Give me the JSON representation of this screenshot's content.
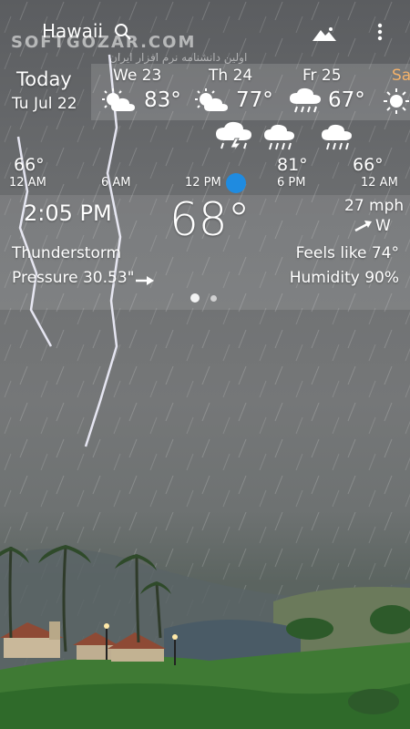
{
  "header": {
    "city": "Hawaii",
    "watermark_title": "SOFTGOZAR.COM",
    "watermark_sub": "اولین دانشنامه نرم افزار ایران"
  },
  "today": {
    "label": "Today",
    "date": "Tu Jul 22"
  },
  "forecast": [
    {
      "day": "We 23",
      "temp": "83°",
      "icon": "partly-cloudy-icon"
    },
    {
      "day": "Th 24",
      "temp": "77°",
      "icon": "partly-cloudy-icon"
    },
    {
      "day": "Fr 25",
      "temp": "67°",
      "icon": "rain-icon"
    },
    {
      "day": "Sa",
      "temp": "",
      "icon": "sun-icon"
    }
  ],
  "hourly": {
    "temps": [
      "66°",
      "81°",
      "66°"
    ],
    "times": [
      "12 AM",
      "6 AM",
      "12 PM",
      "6 PM",
      "12 AM"
    ],
    "icons": [
      "thunderstorm-icon",
      "rain-icon",
      "rain-icon"
    ]
  },
  "current": {
    "time": "2:05 PM",
    "temp": "68°",
    "wind_speed": "27 mph",
    "wind_dir": "W",
    "condition": "Thunderstorm",
    "feels_like": "Feels like 74°",
    "pressure": "Pressure 30.53\"",
    "humidity": "Humidity 90%"
  },
  "pager": {
    "pages": 2,
    "current": 1
  },
  "colors": {
    "accent_dot": "#1f8be0",
    "day_accent": "#f4b26a"
  }
}
